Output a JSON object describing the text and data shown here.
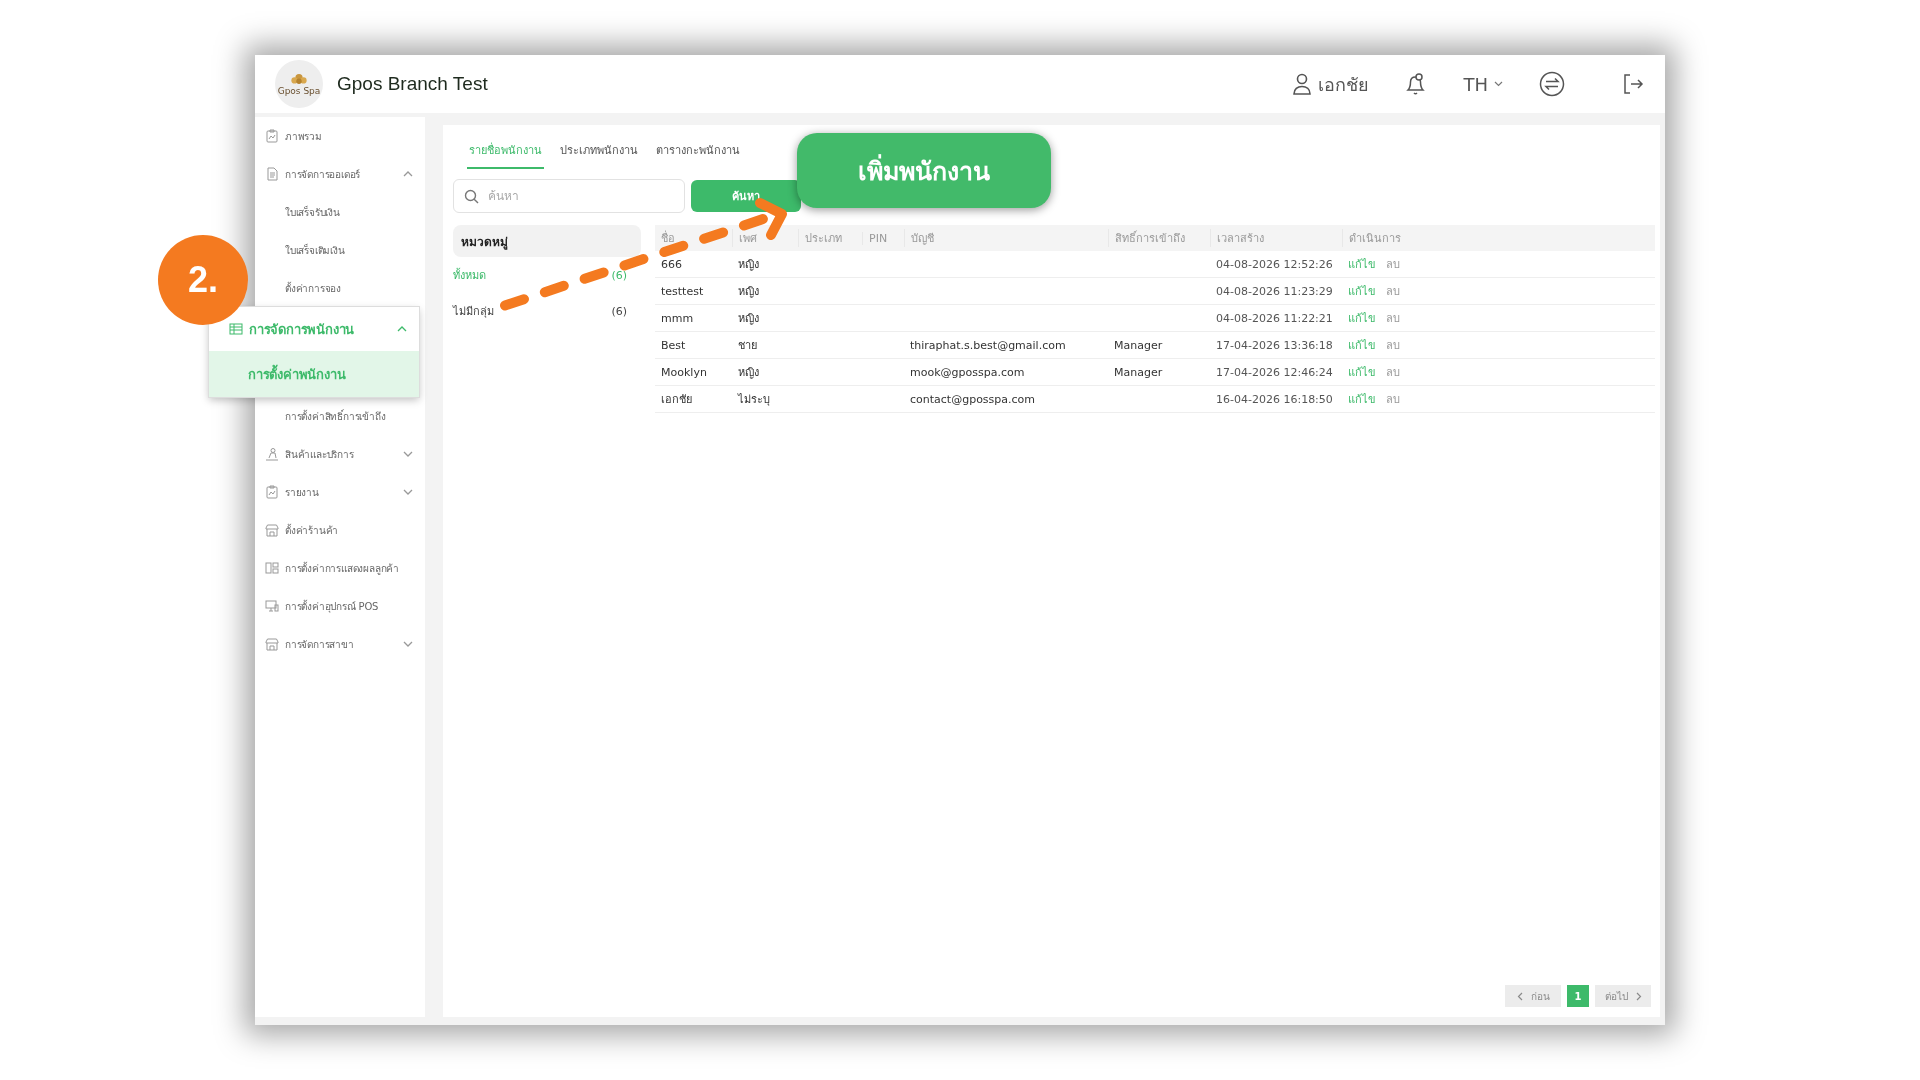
{
  "header": {
    "logo_text": "Gpos Spa",
    "title": "Gpos Branch Test",
    "user": "เอกชัย",
    "language": "TH"
  },
  "sidebar": {
    "items": [
      {
        "label": "ภาพรวม",
        "selected": false,
        "highlighted": false
      },
      {
        "label": "การจัดการออเดอร์",
        "selected": false,
        "highlighted": false,
        "expanded": true,
        "children": [
          {
            "label": "ใบเสร็จรับเงิน",
            "selected": false
          },
          {
            "label": "ใบเสร็จเติมเงิน",
            "selected": false
          },
          {
            "label": "ตั้งค่าการจอง",
            "selected": false
          }
        ]
      },
      {
        "label": "การจัดการพนักงาน",
        "selected": true,
        "highlighted": true,
        "expanded": true,
        "children": [
          {
            "label": "การตั้งค่าพนักงาน",
            "selected": true
          },
          {
            "label": "การตั้งค่าสิทธิ์การเข้าถึง",
            "selected": false
          }
        ]
      },
      {
        "label": "สินค้าและบริการ",
        "selected": false,
        "highlighted": false,
        "expanded": false
      },
      {
        "label": "รายงาน",
        "selected": false,
        "highlighted": false,
        "expanded": false
      },
      {
        "label": "ตั้งค่าร้านค้า",
        "selected": false,
        "highlighted": false
      },
      {
        "label": "การตั้งค่าการแสดงผลลูกค้า",
        "selected": false,
        "highlighted": false
      },
      {
        "label": "การตั้งค่าอุปกรณ์ POS",
        "selected": false,
        "highlighted": false
      },
      {
        "label": "การจัดการสาขา",
        "selected": false,
        "highlighted": false,
        "expanded": false
      }
    ]
  },
  "tabs": [
    {
      "label": "รายชื่อพนักงาน",
      "selected": true
    },
    {
      "label": "ประเภทพนักงาน",
      "selected": false
    },
    {
      "label": "ตารางกะพนักงาน",
      "selected": false
    }
  ],
  "search": {
    "placeholder": "ค้นหา",
    "button": "ค้นหา"
  },
  "categories": {
    "title": "หมวดหมู่",
    "items": [
      {
        "label": "ทั้งหมด",
        "count": "(6)",
        "selected": true
      },
      {
        "label": "ไม่มีกลุ่ม",
        "count": "(6)",
        "selected": false
      }
    ]
  },
  "table": {
    "columns": [
      "ชื่อ",
      "เพศ",
      "ประเภท",
      "PIN",
      "บัญชี",
      "สิทธิ์การเข้าถึง",
      "เวลาสร้าง",
      "ดำเนินการ"
    ],
    "rows": [
      {
        "name": "666",
        "gender": "หญิง",
        "created": "04-08-2026 12:52:26",
        "actions": [
          {
            "label": "แก้ไข",
            "kind": "edit"
          },
          {
            "label": "ลบ",
            "kind": "delete"
          }
        ]
      },
      {
        "name": "testtest",
        "gender": "หญิง",
        "created": "04-08-2026 11:23:29",
        "actions": [
          {
            "label": "แก้ไข",
            "kind": "edit"
          },
          {
            "label": "ลบ",
            "kind": "delete"
          }
        ]
      },
      {
        "name": "mmm",
        "gender": "หญิง",
        "created": "04-08-2026 11:22:21",
        "actions": [
          {
            "label": "แก้ไข",
            "kind": "edit"
          },
          {
            "label": "ลบ",
            "kind": "delete"
          }
        ]
      },
      {
        "name": "Best",
        "gender": "ชาย",
        "account": "thiraphat.s.best@gmail.com",
        "role": "Manager",
        "created": "17-04-2026 13:36:18",
        "actions": [
          {
            "label": "แก้ไข",
            "kind": "edit"
          },
          {
            "label": "ลบ",
            "kind": "delete"
          }
        ]
      },
      {
        "name": "Mooklyn",
        "gender": "หญิง",
        "account": "mook@gposspa.com",
        "role": "Manager",
        "created": "17-04-2026 12:46:24",
        "actions": [
          {
            "label": "แก้ไข",
            "kind": "edit"
          },
          {
            "label": "ลบ",
            "kind": "delete"
          }
        ]
      },
      {
        "name": "เอกชัย",
        "gender": "ไม่ระบุ",
        "account": "contact@gposspa.com",
        "created": "16-04-2026 16:18:50",
        "actions": [
          {
            "label": "แก้ไข",
            "kind": "edit"
          },
          {
            "label": "ลบ",
            "kind": "delete"
          }
        ]
      }
    ]
  },
  "pagination": {
    "prev": {
      "label": "ก่อน",
      "disabled": true
    },
    "pages": [
      {
        "label": "1",
        "selected": true
      }
    ],
    "next": {
      "label": "ต่อไป",
      "disabled": true
    }
  },
  "tutorial": {
    "step": "2.",
    "callout": "เพิ่มพนักงาน"
  }
}
